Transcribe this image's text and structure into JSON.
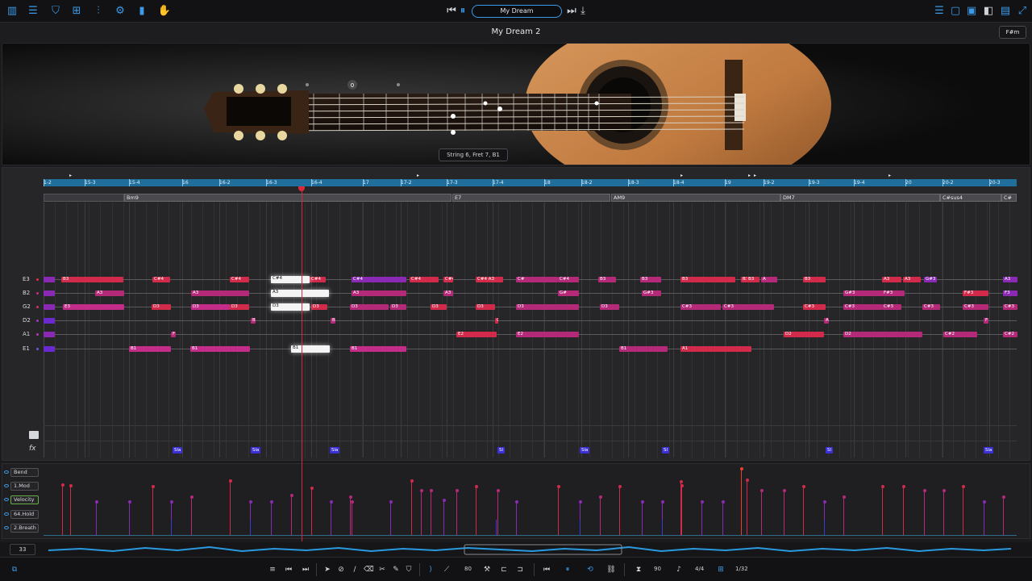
{
  "transport": {
    "song_name": "My Dream"
  },
  "header": {
    "title": "My Dream 2",
    "key": "F#m"
  },
  "guitar": {
    "fret_marker_value": "0",
    "position_info": "String 6, Fret 7, B1"
  },
  "ruler": {
    "labels": [
      "1-2",
      "15-3",
      "15-4",
      "16",
      "16-2",
      "16-3",
      "16-4",
      "17",
      "17-2",
      "17-3",
      "17-4",
      "18",
      "18-2",
      "18-3",
      "18-4",
      "19",
      "19-2",
      "19-3",
      "19-4",
      "20",
      "20-2",
      "20-3"
    ]
  },
  "chords": [
    "Bm9",
    "E7",
    "AM9",
    "DM7",
    "C#sus4",
    "C#"
  ],
  "strings": [
    {
      "name": "E3",
      "color": "#e0324c"
    },
    {
      "name": "B2",
      "color": "#c42c8a"
    },
    {
      "name": "G2",
      "color": "#d4306a"
    },
    {
      "name": "D2",
      "color": "#9a3ad0"
    },
    {
      "name": "A1",
      "color": "#b43ab4"
    },
    {
      "name": "E1",
      "color": "#6a5ad8"
    }
  ],
  "notes": {
    "e3": [
      "B3",
      "C#4",
      "C#4",
      "C#4",
      "C#4",
      "C#4",
      "C#4",
      "C#4 A3",
      "C#",
      "C#4",
      "B3",
      "B3",
      "B3",
      "B3",
      "B3",
      "A",
      "B3",
      "A3",
      "A3",
      "G#3",
      "A3",
      "G#3",
      "C#3"
    ],
    "b2": [
      "A3",
      "A3",
      "A3",
      "A3",
      "G#",
      "G#3",
      "G#3",
      "F#3",
      "F#3",
      "F3"
    ],
    "g2": [
      "E3",
      "D3",
      "D3",
      "D3",
      "D3",
      "D3",
      "D3",
      "D3",
      "D3",
      "D3",
      "D3",
      "C#3",
      "C#3",
      "C#3",
      "C#3",
      "C#3",
      "C#3",
      "C#3",
      "C#3",
      "C#3"
    ],
    "d2": [
      "B",
      "B",
      "G#",
      "A",
      "F#"
    ],
    "a1": [
      "F",
      "E2",
      "E2",
      "D2",
      "D2",
      "C#2",
      "C#2"
    ],
    "e1": [
      "B1",
      "B1",
      "B1",
      "B1",
      "A1",
      "A1"
    ]
  },
  "fx_row": {
    "tags": [
      "Sla",
      "Sla",
      "Sla",
      "Sl",
      "Sla",
      "Sl",
      "Sl",
      "Sla"
    ]
  },
  "automation": {
    "lanes": [
      "Bend",
      "1.Mod",
      "Velocity",
      "64.Hold",
      "2.Breath"
    ]
  },
  "status": {
    "bar_counter": "33"
  },
  "bottom_toolbar": {
    "quantize_value": "80",
    "tempo": "90",
    "time_signature": "4/4",
    "grid": "1/32"
  }
}
